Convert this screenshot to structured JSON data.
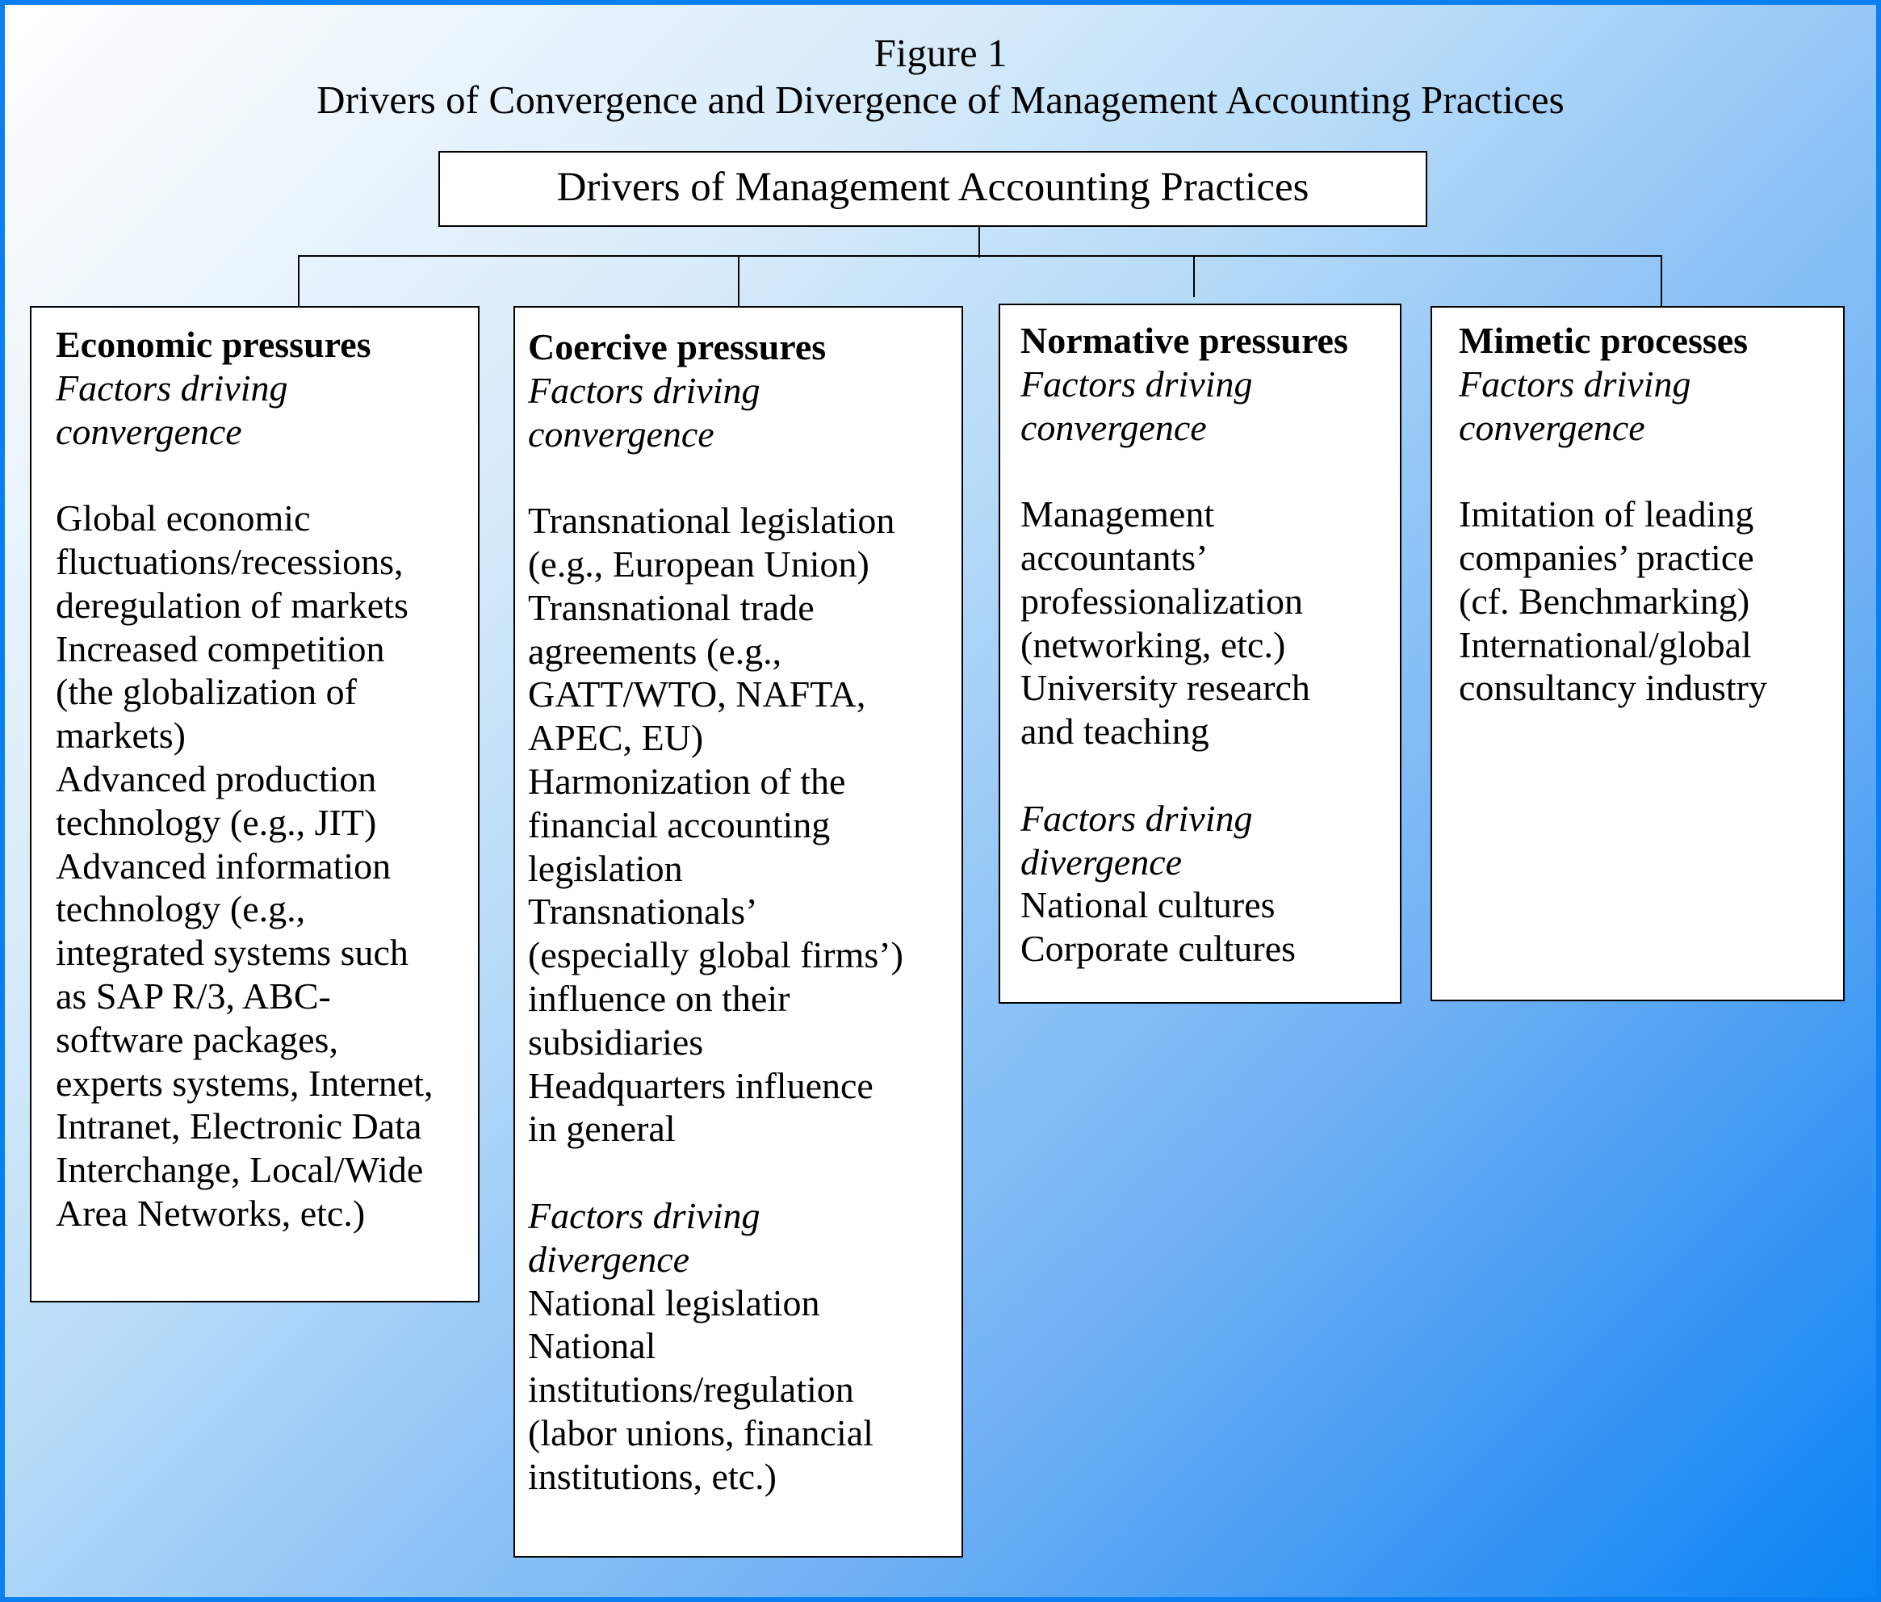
{
  "figure": {
    "label": "Figure 1",
    "title": "Drivers of Convergence and Divergence of Management Accounting Practices"
  },
  "colors": {
    "border": "#0a7ff2",
    "background_start": "#ffffff",
    "background_end": "#0a84f5",
    "box_fill": "#ffffff",
    "line": "#000000"
  },
  "root": {
    "label": "Drivers of Management Accounting Practices"
  },
  "columns": [
    {
      "heading": "Economic pressures",
      "sections": [
        {
          "subheading_lines": [
            "Factors driving",
            "convergence"
          ],
          "lines": [
            "",
            "Global economic",
            "fluctuations/recessions,",
            "deregulation of markets",
            "Increased competition",
            "(the globalization of",
            "markets)",
            "Advanced production",
            "technology (e.g., JIT)",
            "Advanced information",
            "technology (e.g.,",
            "integrated systems such",
            "as SAP R/3, ABC-",
            "software packages,",
            "experts systems, Internet,",
            "Intranet, Electronic Data",
            "Interchange, Local/Wide",
            "Area Networks, etc.)"
          ]
        }
      ]
    },
    {
      "heading": "Coercive pressures",
      "sections": [
        {
          "subheading_lines": [
            "Factors driving",
            "convergence"
          ],
          "lines": [
            "",
            "Transnational legislation",
            "(e.g., European Union)",
            "Transnational trade",
            "agreements (e.g.,",
            "GATT/WTO, NAFTA,",
            "APEC, EU)",
            "Harmonization of the",
            "financial accounting",
            "legislation",
            "Transnationals’",
            "(especially global firms’)",
            "influence on their",
            "subsidiaries",
            "Headquarters influence",
            "in general",
            ""
          ]
        },
        {
          "subheading_lines": [
            "Factors driving",
            "divergence"
          ],
          "lines": [
            "National legislation",
            "National",
            "institutions/regulation",
            "(labor unions, financial",
            "institutions, etc.)"
          ]
        }
      ]
    },
    {
      "heading": "Normative pressures",
      "sections": [
        {
          "subheading_lines": [
            "Factors driving",
            "convergence"
          ],
          "lines": [
            "",
            "Management",
            "accountants’",
            "professionalization",
            "(networking, etc.)",
            "University research",
            "and teaching",
            ""
          ]
        },
        {
          "subheading_lines": [
            "Factors driving",
            "divergence"
          ],
          "lines": [
            "National cultures",
            "Corporate cultures"
          ]
        }
      ]
    },
    {
      "heading": "Mimetic processes",
      "sections": [
        {
          "subheading_lines": [
            "Factors driving",
            "convergence"
          ],
          "lines": [
            "",
            "Imitation of leading",
            "companies’ practice",
            "(cf.  Benchmarking)",
            "International/global",
            "consultancy industry"
          ]
        }
      ]
    }
  ]
}
